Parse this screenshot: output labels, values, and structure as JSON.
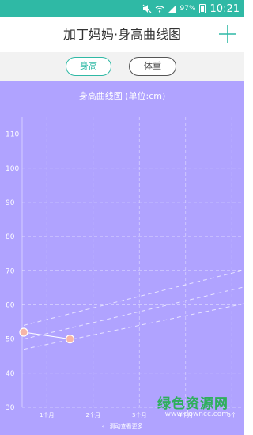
{
  "status_bar": {
    "icons": [
      "mute-icon",
      "wifi-icon",
      "signal-icon",
      "battery-icon"
    ],
    "battery_text": "97%",
    "time": "10:21"
  },
  "app_bar": {
    "title": "加丁妈妈·身高曲线图"
  },
  "tabs": [
    {
      "label": "身高",
      "active": true
    },
    {
      "label": "体重",
      "active": false
    }
  ],
  "chart_data": {
    "type": "line",
    "title": "身高曲线图 (单位:cm)",
    "x_ticks": [
      "1个月",
      "2个月",
      "3个月",
      "4个月",
      "5个"
    ],
    "y_ticks": [
      30,
      40,
      50,
      60,
      70,
      80,
      90,
      100,
      110
    ],
    "ylim": [
      30,
      115
    ],
    "xlim": [
      0,
      4.85
    ],
    "grid": true,
    "series": [
      {
        "x": [
          0,
          1
        ],
        "values": [
          52,
          50
        ],
        "color": "#ffffff",
        "marker": "#f6b5a7"
      }
    ],
    "reference_curves": [
      {
        "x": [
          0,
          5
        ],
        "values": [
          54,
          71
        ],
        "style": "dashed"
      },
      {
        "x": [
          0,
          5
        ],
        "values": [
          50,
          66
        ],
        "style": "dashed"
      },
      {
        "x": [
          0,
          5
        ],
        "values": [
          47,
          61
        ],
        "style": "dashed"
      }
    ]
  },
  "scroll_hint": "滑动查看更多",
  "watermark": {
    "text": "绿色资源网",
    "url": "www.downcc.com"
  },
  "colors": {
    "accent": "#2fb9a5",
    "chart_bg": "#b0a3ff"
  }
}
